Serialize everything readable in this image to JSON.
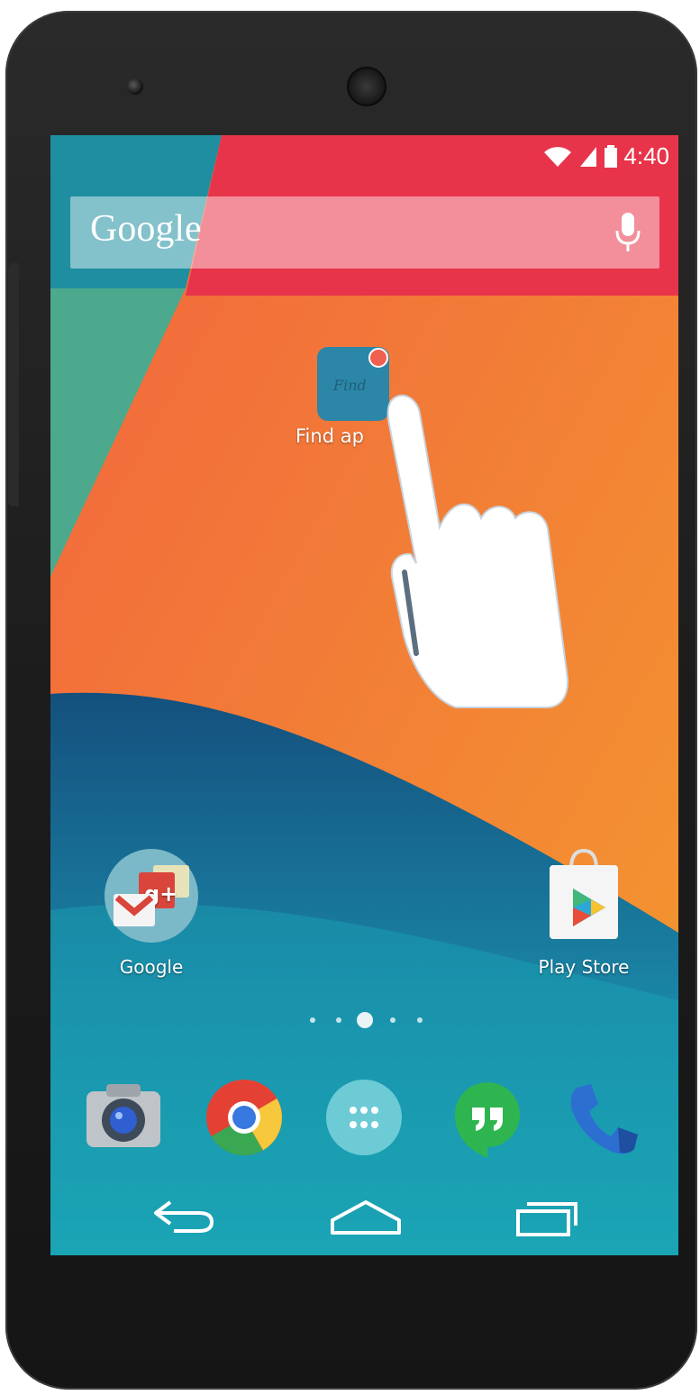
{
  "status_bar": {
    "time": "4:40"
  },
  "search": {
    "label": "Google"
  },
  "folder": {
    "label": "Find ap",
    "icon_text": "Find"
  },
  "home_apps": [
    {
      "label": "Google",
      "icon": "google-folder-icon"
    },
    {
      "label": "Play Store",
      "icon": "play-store-icon"
    }
  ],
  "page_indicator": {
    "count": 5,
    "current": 3
  },
  "dock": [
    {
      "icon": "camera-icon"
    },
    {
      "icon": "chrome-icon"
    },
    {
      "icon": "app-drawer-icon"
    },
    {
      "icon": "hangouts-icon"
    },
    {
      "icon": "phone-icon"
    }
  ],
  "nav": {
    "buttons": [
      "back-icon",
      "home-icon",
      "recents-icon"
    ]
  },
  "colors": {
    "red": "#E8344A",
    "orange": "#F47A3A",
    "teal": "#1A9CB0",
    "blue": "#125E8A",
    "green": "#4CA98D"
  }
}
